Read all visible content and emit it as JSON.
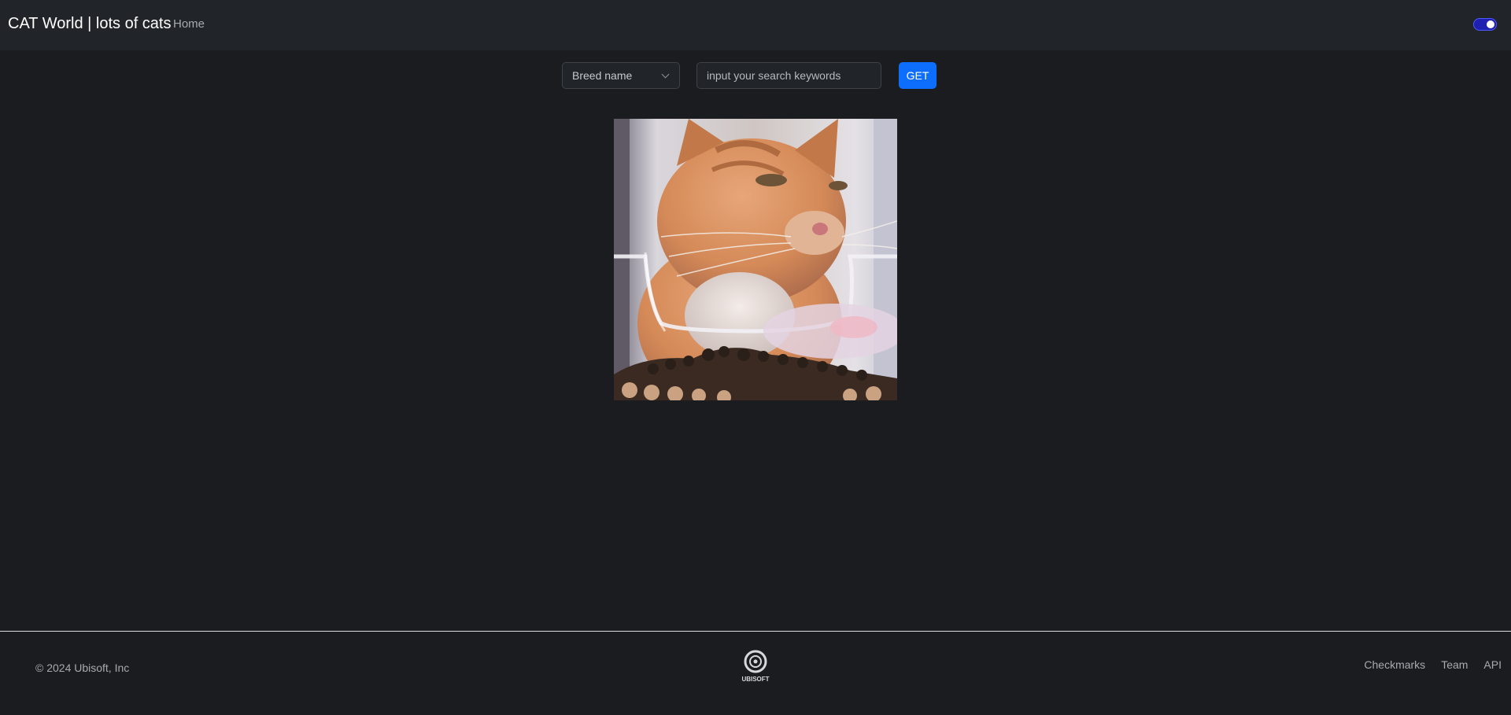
{
  "navbar": {
    "brand": "CAT World | lots of cats",
    "links": [
      "Home"
    ]
  },
  "search": {
    "breed_select_value": "Breed name",
    "keyword_placeholder": "input your search keywords",
    "submit_label": "GET"
  },
  "theme_toggle": {
    "state": "on",
    "accent": "#1f1fb0"
  },
  "footer": {
    "copyright": "© 2024 Ubisoft, Inc",
    "logo_text": "UBISOFT",
    "links": [
      "Checkmarks",
      "Team",
      "API"
    ]
  },
  "colors": {
    "page_bg": "#1a1c1f",
    "nav_bg": "#212429",
    "primary": "#0d6efd"
  }
}
